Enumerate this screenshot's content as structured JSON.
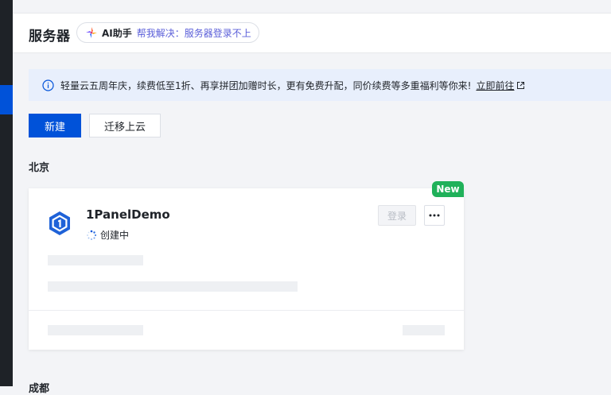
{
  "header": {
    "title": "服务器",
    "ai_assistant": {
      "name": "AI助手",
      "hint": "帮我解决：服务器登录不上"
    }
  },
  "notice": {
    "text": "轻量云五周年庆，续费低至1折、再享拼团加赠时长，更有免费升配，同价续费等多重福利等你来!",
    "link": "立即前往",
    "icon": "info-icon"
  },
  "actions": {
    "create": "新建",
    "migrate": "迁移上云"
  },
  "regions": [
    {
      "name": "北京",
      "instances": [
        {
          "badge": "New",
          "name": "1PanelDemo",
          "status": "创建中",
          "login": "登录",
          "more_icon": "more-icon"
        }
      ]
    },
    {
      "name": "成都"
    }
  ],
  "colors": {
    "primary": "#0052d9",
    "notice_bg": "#e8effc",
    "new_badge": "#20b15a",
    "ai_hint": "#5b5fd9",
    "rail": "#1e2227"
  }
}
